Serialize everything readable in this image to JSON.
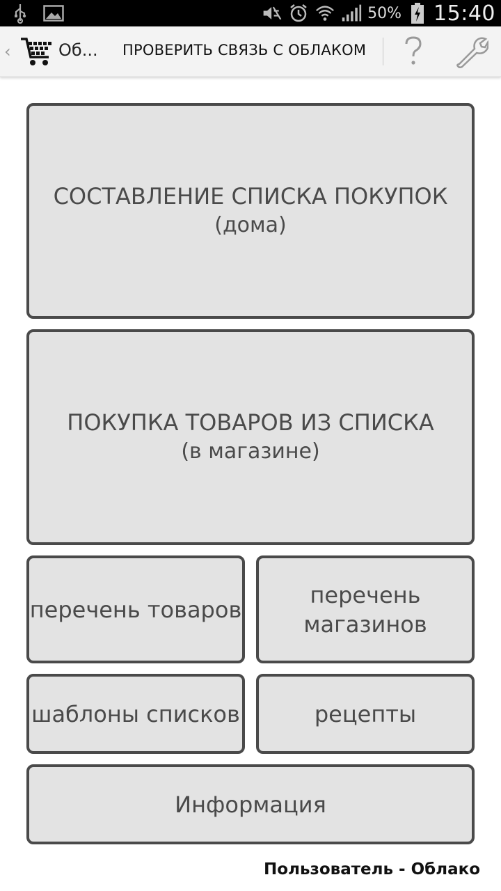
{
  "status_bar": {
    "battery_percent": "50%",
    "time": "15:40",
    "icons": [
      "usb-icon",
      "image-icon",
      "mute-icon",
      "alarm-icon",
      "wifi-icon",
      "signal-icon",
      "battery-charging-icon"
    ]
  },
  "action_bar": {
    "title": "Об...",
    "check_cloud_label": "ПРОВЕРИТЬ СВЯЗЬ С ОБЛАКОМ",
    "help_glyph": "?"
  },
  "tiles": {
    "compose": {
      "title": "СОСТАВЛЕНИЕ СПИСКА ПОКУПОК",
      "sub": "(дома)"
    },
    "buy": {
      "title": "ПОКУПКА ТОВАРОВ ИЗ СПИСКА",
      "sub": "(в магазине)"
    },
    "goods": {
      "label": "перечень товаров"
    },
    "shops": {
      "line1": "перечень",
      "line2": "магазинов"
    },
    "templates": {
      "label": "шаблоны списков"
    },
    "recipes": {
      "label": "рецепты"
    },
    "info": {
      "label": "Информация"
    }
  },
  "footer": {
    "user_label": "Пользователь - Облако"
  },
  "colors": {
    "tile_bg": "#e3e3e3",
    "tile_border": "#4a4a4a",
    "tile_text": "#4a4a4a",
    "actionbar_bg": "#f3f3f3"
  }
}
